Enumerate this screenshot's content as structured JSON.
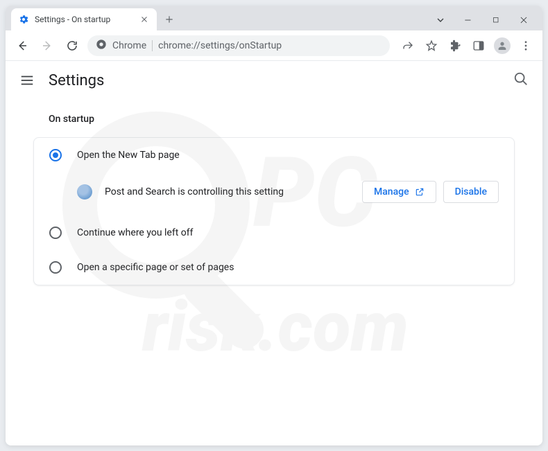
{
  "tab": {
    "title": "Settings - On startup"
  },
  "omnibox": {
    "scheme_label": "Chrome",
    "url": "chrome://settings/onStartup"
  },
  "header": {
    "title": "Settings"
  },
  "section": {
    "title": "On startup"
  },
  "options": [
    {
      "label": "Open the New Tab page",
      "selected": true
    },
    {
      "label": "Continue where you left off",
      "selected": false
    },
    {
      "label": "Open a specific page or set of pages",
      "selected": false
    }
  ],
  "extension_notice": {
    "text": "Post and Search is controlling this setting",
    "manage_label": "Manage",
    "disable_label": "Disable"
  }
}
